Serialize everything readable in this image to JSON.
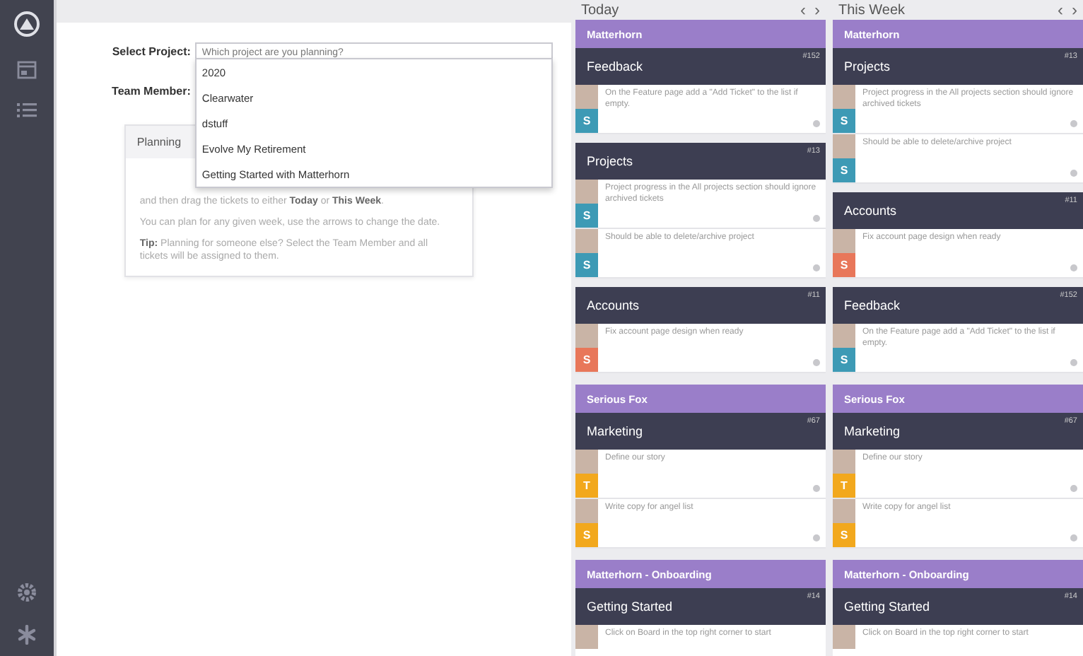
{
  "sidebar": {
    "items": [
      {
        "kind": "logo"
      },
      {
        "kind": "calendar"
      },
      {
        "kind": "list"
      }
    ],
    "bottom_items": [
      {
        "kind": "gear"
      },
      {
        "kind": "star"
      }
    ]
  },
  "form": {
    "select_project": {
      "label": "Select Project:",
      "placeholder": "Which project are you planning?",
      "options": [
        "2020",
        "Clearwater",
        "dstuff",
        "Evolve My Retirement",
        "Getting Started with Matterhorn"
      ]
    },
    "team_member": {
      "label": "Team Member:"
    }
  },
  "planning_card": {
    "title": "Planning",
    "paragraphs": [
      "and then drag the tickets to either **Today** or **This Week**.",
      "You can plan for any given week, use the arrows to change the date.",
      "**Tip:** Planning for someone else? Select the Team Member and all tickets will be assigned to them."
    ]
  },
  "columns": [
    {
      "title": "Today",
      "prev": "‹",
      "next": "›",
      "groups": [
        {
          "project": "Matterhorn",
          "categories": [
            {
              "name": "Feedback",
              "number": "#152",
              "tickets": [
                {
                  "text": "On the Feature page add a \"Add Ticket\" to the list if empty.",
                  "initial": "S",
                  "color": "#3d9ab5"
                }
              ]
            },
            {
              "name": "Projects",
              "number": "#13",
              "tickets": [
                {
                  "text": "Project progress in the All projects section should ignore archived tickets",
                  "initial": "S",
                  "color": "#3d9ab5"
                },
                {
                  "text": "Should be able to delete/archive project",
                  "initial": "S",
                  "color": "#3d9ab5"
                }
              ]
            },
            {
              "name": "Accounts",
              "number": "#11",
              "tickets": [
                {
                  "text": "Fix account page design when ready",
                  "initial": "S",
                  "color": "#e8775a"
                }
              ]
            }
          ]
        },
        {
          "project": "Serious Fox",
          "categories": [
            {
              "name": "Marketing",
              "number": "#67",
              "tickets": [
                {
                  "text": "Define our story",
                  "initial": "T",
                  "color": "#f2a81d"
                },
                {
                  "text": "Write copy for angel list",
                  "initial": "S",
                  "color": "#f2a81d"
                }
              ]
            }
          ]
        },
        {
          "project": "Matterhorn - Onboarding",
          "categories": [
            {
              "name": "Getting Started",
              "number": "#14",
              "tickets": [
                {
                  "text": "Click on Board in the top right corner to start"
                }
              ]
            }
          ]
        }
      ]
    },
    {
      "title": "This Week",
      "prev": "‹",
      "next": "›",
      "groups": [
        {
          "project": "Matterhorn",
          "categories": [
            {
              "name": "Projects",
              "number": "#13",
              "tickets": [
                {
                  "text": "Project progress in the All projects section should ignore archived tickets",
                  "initial": "S",
                  "color": "#3d9ab5"
                },
                {
                  "text": "Should be able to delete/archive project",
                  "initial": "S",
                  "color": "#3d9ab5"
                }
              ]
            },
            {
              "name": "Accounts",
              "number": "#11",
              "tickets": [
                {
                  "text": "Fix account page design when ready",
                  "initial": "S",
                  "color": "#e8775a"
                }
              ]
            },
            {
              "name": "Feedback",
              "number": "#152",
              "tickets": [
                {
                  "text": "On the Feature page add a \"Add Ticket\" to the list if empty.",
                  "initial": "S",
                  "color": "#3d9ab5"
                }
              ]
            }
          ]
        },
        {
          "project": "Serious Fox",
          "categories": [
            {
              "name": "Marketing",
              "number": "#67",
              "tickets": [
                {
                  "text": "Define our story",
                  "initial": "T",
                  "color": "#f2a81d"
                },
                {
                  "text": "Write copy for angel list",
                  "initial": "S",
                  "color": "#f2a81d"
                }
              ]
            }
          ]
        },
        {
          "project": "Matterhorn - Onboarding",
          "categories": [
            {
              "name": "Getting Started",
              "number": "#14",
              "tickets": [
                {
                  "text": "Click on Board in the top right corner to start"
                }
              ]
            }
          ]
        }
      ]
    }
  ]
}
